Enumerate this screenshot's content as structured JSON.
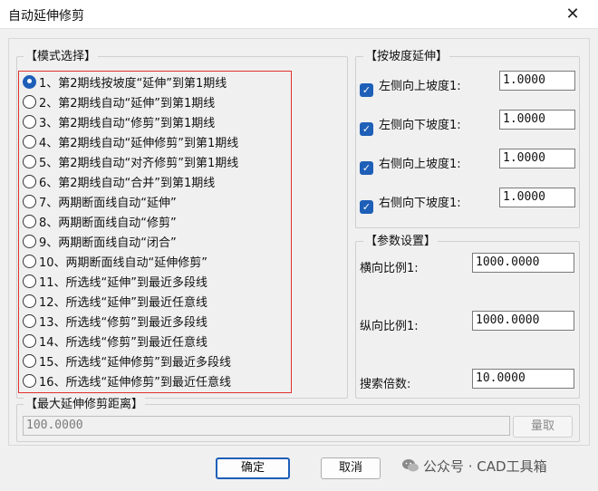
{
  "window": {
    "title": "自动延伸修剪",
    "close_glyph": "✕"
  },
  "mode_group": {
    "title": "【模式选择】",
    "selected_index": 0,
    "options": [
      "1、第2期线按坡度“延伸”到第1期线",
      "2、第2期线自动“延伸”到第1期线",
      "3、第2期线自动“修剪”到第1期线",
      "4、第2期线自动“延伸修剪”到第1期线",
      "5、第2期线自动“对齐修剪”到第1期线",
      "6、第2期线自动“合并”到第1期线",
      "7、两期断面线自动“延伸”",
      "8、两期断面线自动“修剪”",
      "9、两期断面线自动“闭合”",
      "10、两期断面线自动“延伸修剪”",
      "11、所选线“延伸”到最近多段线",
      "12、所选线“延伸”到最近任意线",
      "13、所选线“修剪”到最近多段线",
      "14、所选线“修剪”到最近任意线",
      "15、所选线“延伸修剪”到最近多段线",
      "16、所选线“延伸修剪”到最近任意线"
    ]
  },
  "slope_group": {
    "title": "【按坡度延伸】",
    "rows": [
      {
        "label": "左侧向上坡度1:",
        "value": "1.0000",
        "checked": true
      },
      {
        "label": "左侧向下坡度1:",
        "value": "1.0000",
        "checked": true
      },
      {
        "label": "右侧向上坡度1:",
        "value": "1.0000",
        "checked": true
      },
      {
        "label": "右侧向下坡度1:",
        "value": "1.0000",
        "checked": true
      }
    ]
  },
  "param_group": {
    "title": "【参数设置】",
    "h_scale_label": "横向比例1:",
    "h_scale_value": "1000.0000",
    "v_scale_label": "纵向比例1:",
    "v_scale_value": "1000.0000",
    "search_label": "搜索倍数:",
    "search_value": "10.0000"
  },
  "distance_group": {
    "title": "【最大延伸修剪距离】",
    "value": "100.0000",
    "measure_label": "量取"
  },
  "buttons": {
    "ok": "确定",
    "cancel": "取消"
  },
  "watermark": {
    "text": "公众号 · CAD工具箱"
  },
  "colors": {
    "accent": "#1e5fb8",
    "highlight_border": "#e0312c"
  }
}
